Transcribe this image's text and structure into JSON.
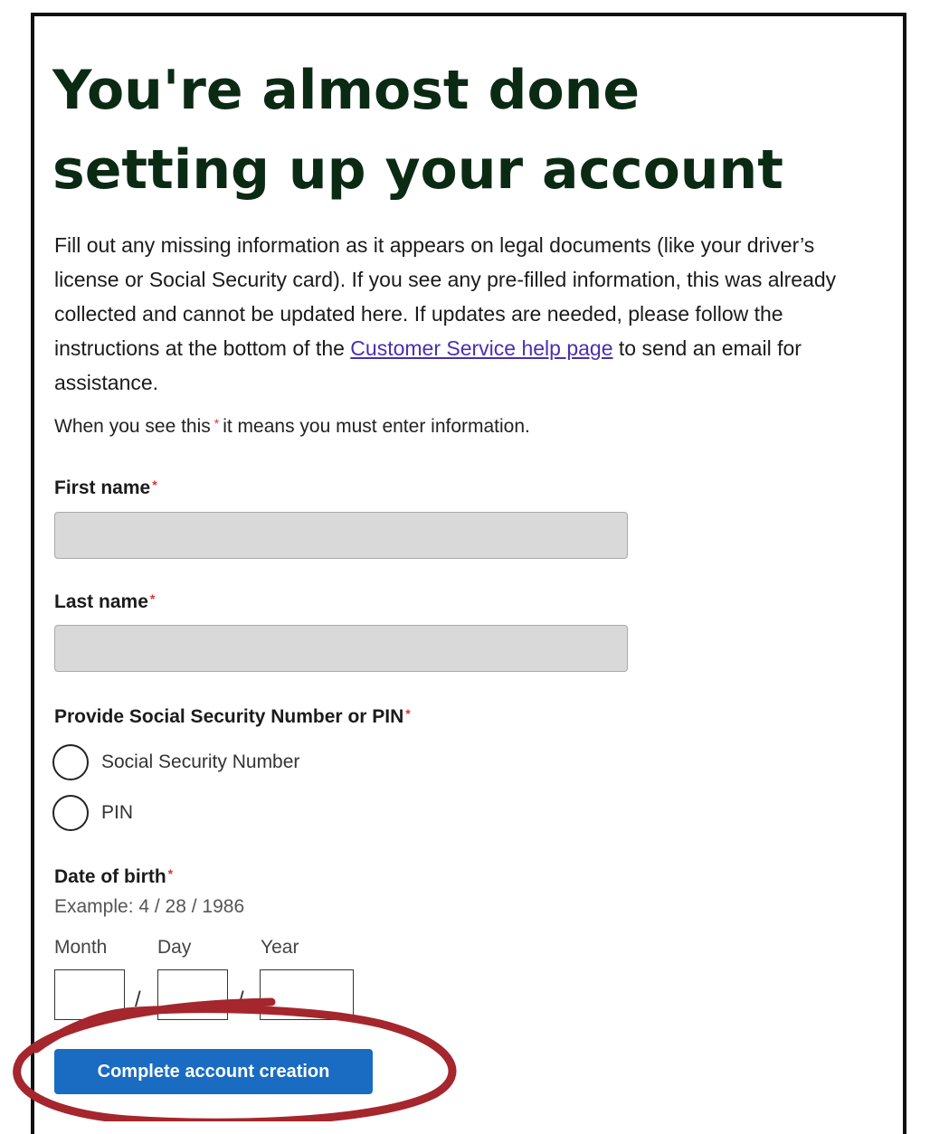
{
  "page": {
    "title": "You're almost done setting up your account",
    "intro_before_link": "Fill out any missing information as it appears on legal documents (like your driver’s license or Social Security card). If you see any pre-filled information, this was already collected and cannot be updated here. If updates are needed, please follow the instructions at the bottom of the ",
    "intro_link": "Customer Service help page",
    "intro_after_link": " to send an email for assistance.",
    "required_note_before": "When you see this",
    "required_star": "*",
    "required_note_after": "it means you must enter information."
  },
  "form": {
    "first_name": {
      "label": "First name",
      "value": "",
      "disabled": true
    },
    "last_name": {
      "label": "Last name",
      "value": "",
      "disabled": true
    },
    "id_choice": {
      "label": "Provide Social Security Number or PIN",
      "options": [
        "Social Security Number",
        "PIN"
      ],
      "selected": null
    },
    "dob": {
      "label": "Date of birth",
      "hint": "Example: 4 / 28 / 1986",
      "month_label": "Month",
      "day_label": "Day",
      "year_label": "Year",
      "separator": "/",
      "month": "",
      "day": "",
      "year": ""
    },
    "submit_label": "Complete account creation"
  },
  "colors": {
    "title": "#0b2a14",
    "link": "#4b2fb0",
    "required_star": "#dd3333",
    "button": "#1a6bc2",
    "annotation_circle": "#a5262c"
  }
}
